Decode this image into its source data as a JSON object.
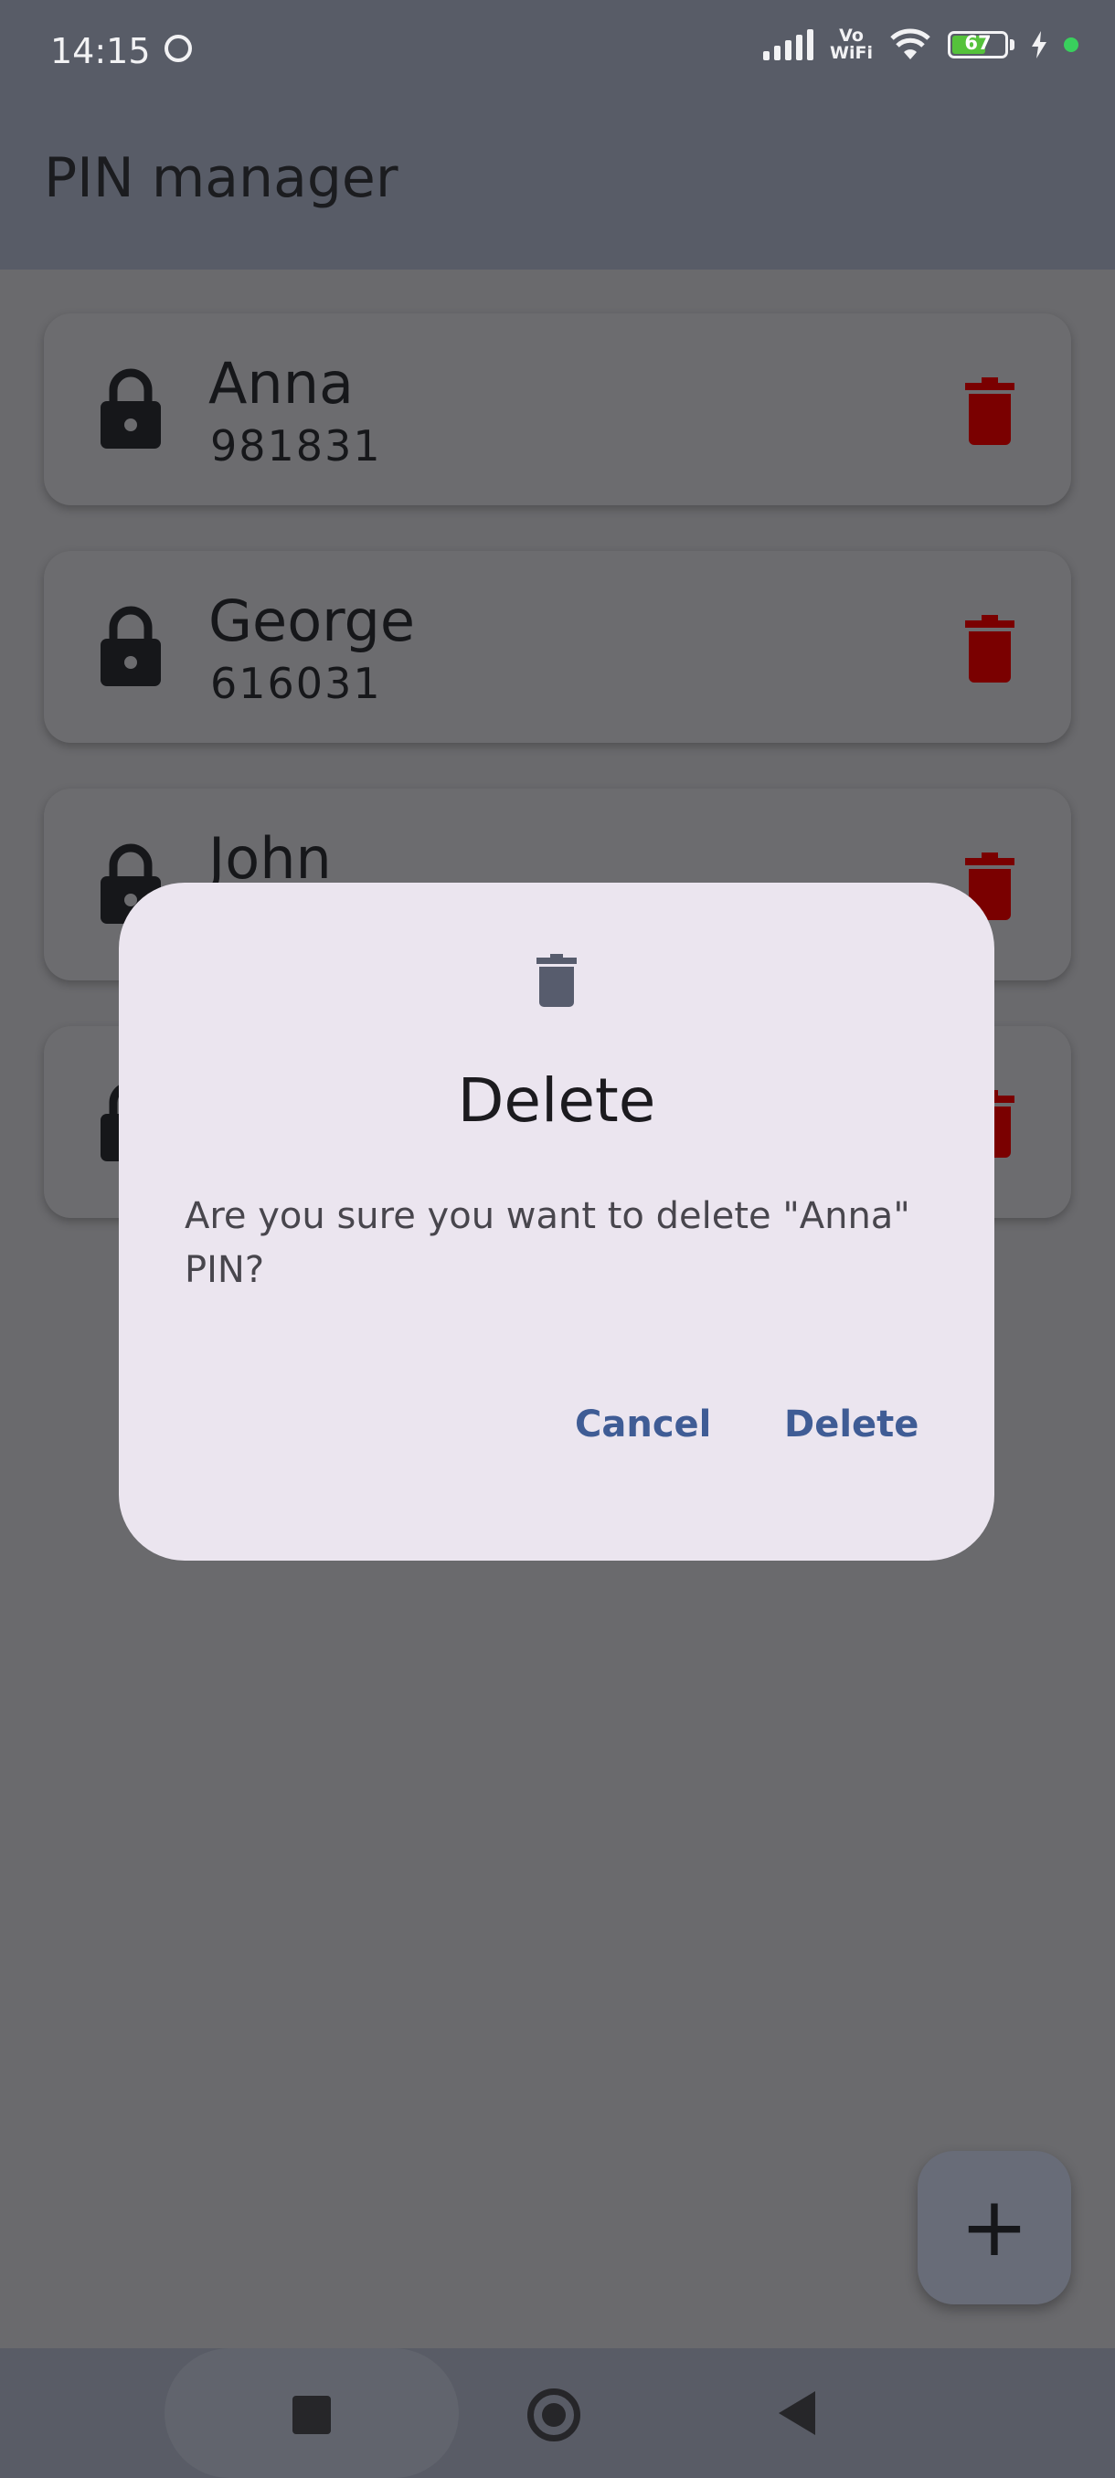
{
  "status_bar": {
    "time": "14:15",
    "vowifi_top": "Vo",
    "vowifi_bottom": "WiFi",
    "battery": "67",
    "icons": [
      "face-icon",
      "signal-icon",
      "vowifi-icon",
      "wifi-icon",
      "battery-icon",
      "charging-icon",
      "dot-icon"
    ]
  },
  "app_bar": {
    "title": "PIN manager"
  },
  "pins": [
    {
      "name": "Anna",
      "pin": "981831"
    },
    {
      "name": "George",
      "pin": "616031"
    },
    {
      "name": "John",
      "pin": ""
    },
    {
      "name": "",
      "pin": ""
    }
  ],
  "dialog": {
    "icon": "trash-icon",
    "title": "Delete",
    "message": "Are you sure you want to delete \"Anna\" PIN?",
    "cancel_label": "Cancel",
    "confirm_label": "Delete"
  },
  "fab": {
    "label": "+"
  },
  "colors": {
    "delete_icon": "#7a0000",
    "lock_icon": "#16171a",
    "accent": "#3f5c95",
    "dialog_bg": "#ebe5ef"
  }
}
